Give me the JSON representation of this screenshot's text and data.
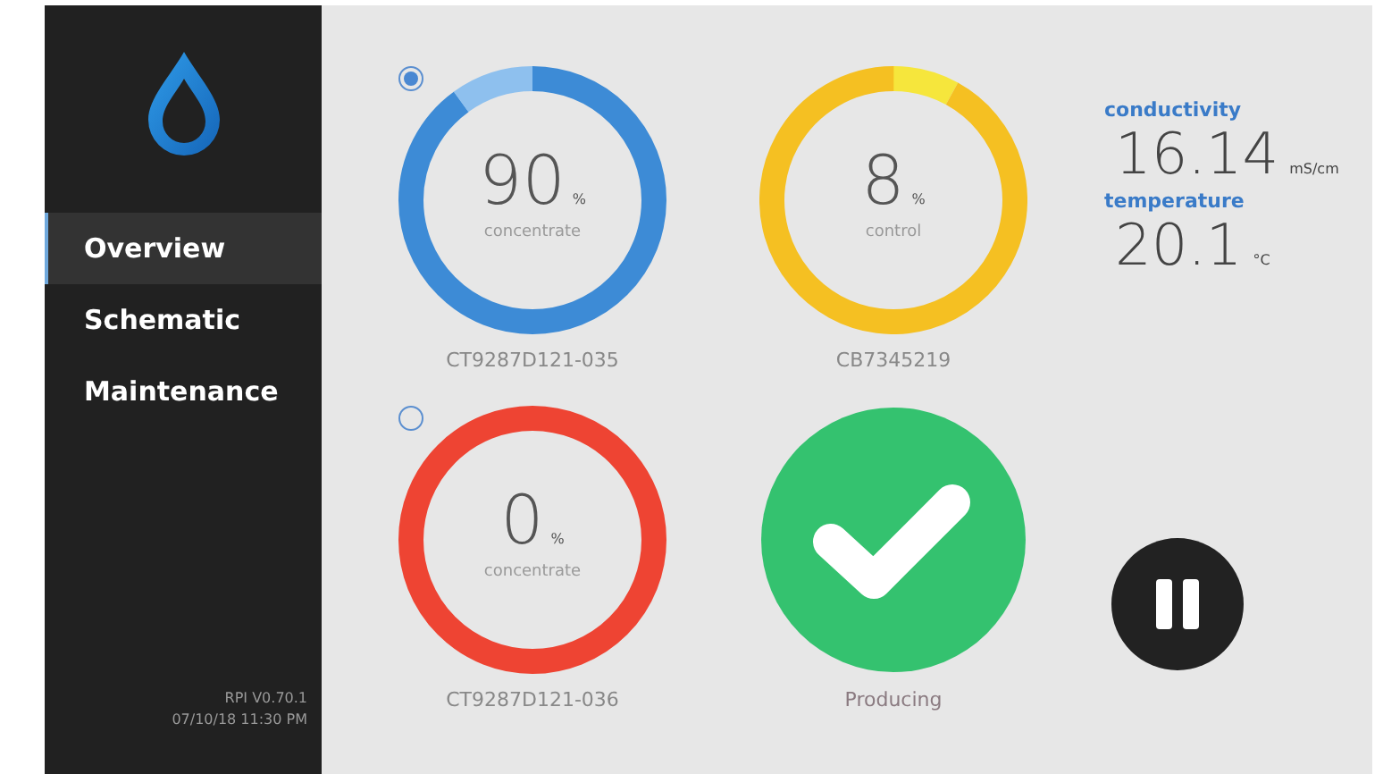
{
  "sidebar": {
    "items": [
      {
        "label": "Overview",
        "selected": true
      },
      {
        "label": "Schematic",
        "selected": false
      },
      {
        "label": "Maintenance",
        "selected": false
      }
    ],
    "version": "RPI V0.70.1",
    "timestamp": "07/10/18 11:30 PM"
  },
  "gauges": [
    {
      "value": "90",
      "unit": "%",
      "caption": "concentrate",
      "id_label": "CT9287D121-035",
      "segments": [
        {
          "color": "#3d8bd6"
        },
        {
          "color": "#8ec0ee"
        }
      ],
      "radio": {
        "selected": true
      }
    },
    {
      "value": "8",
      "unit": "%",
      "caption": "control",
      "id_label": "CB7345219",
      "segments": [
        {
          "color": "#f6e63c"
        },
        {
          "color": "#f5c022"
        }
      ]
    },
    {
      "value": "0",
      "unit": "%",
      "caption": "concentrate",
      "id_label": "CT9287D121-036",
      "segments": [
        {
          "color": "#ee4433"
        }
      ],
      "radio": {
        "selected": false
      }
    }
  ],
  "readings": [
    {
      "label": "conductivity",
      "value": "16.14",
      "unit": "mS/cm"
    },
    {
      "label": "temperature",
      "value": "20.1",
      "unit": "°C"
    }
  ],
  "status": {
    "label": "Producing",
    "kind": "ok"
  }
}
